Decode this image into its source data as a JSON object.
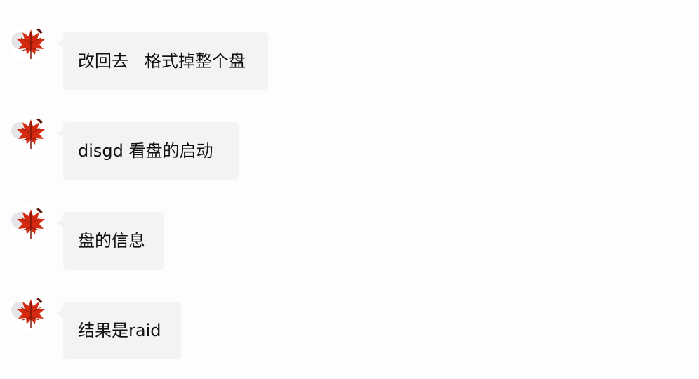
{
  "chat": {
    "messages": [
      {
        "sender_avatar": "maple-leaf-avatar",
        "text": "改回去   格式掉整个盘"
      },
      {
        "sender_avatar": "maple-leaf-avatar",
        "text": "disgd 看盘的启动"
      },
      {
        "sender_avatar": "maple-leaf-avatar",
        "text": "盘的信息"
      },
      {
        "sender_avatar": "maple-leaf-avatar",
        "text": "结果是raid"
      }
    ]
  },
  "colors": {
    "background": "#fdfdfe",
    "bubble": "#f3f3f4",
    "text": "#111111",
    "leaf": "#d42a10"
  }
}
